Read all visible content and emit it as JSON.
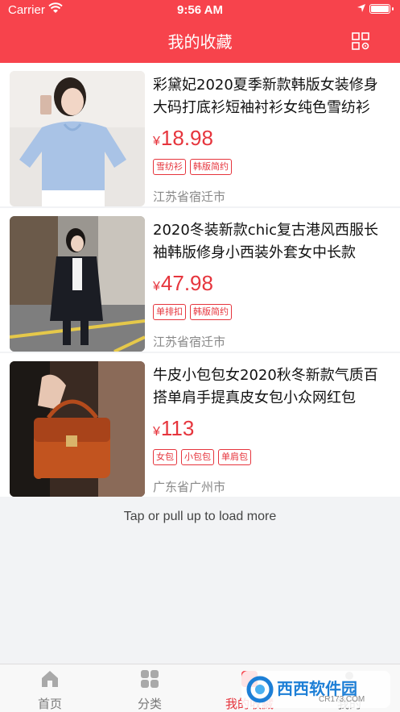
{
  "status": {
    "carrier": "Carrier",
    "time": "9:56 AM"
  },
  "nav": {
    "title": "我的收藏",
    "right_icon": "qr-scan-icon"
  },
  "items": [
    {
      "title": "彩黛妃2020夏季新款韩版女装修身大码打底衫短袖衬衫女纯色雪纺衫",
      "currency": "¥",
      "price": "18.98",
      "tags": [
        "雪纺衫",
        "韩版简约"
      ],
      "location": "江苏省宿迁市"
    },
    {
      "title": "2020冬装新款chic复古港风西服长袖韩版修身小西装外套女中长款",
      "currency": "¥",
      "price": "47.98",
      "tags": [
        "单排扣",
        "韩版简约"
      ],
      "location": "江苏省宿迁市"
    },
    {
      "title": "牛皮小包包女2020秋冬新款气质百搭单肩手提真皮女包小众网红包",
      "currency": "¥",
      "price": "113",
      "tags": [
        "女包",
        "小包包",
        "单肩包"
      ],
      "location": "广东省广州市"
    }
  ],
  "load_more": "Tap or pull up to load more",
  "tabs": [
    {
      "label": "首页",
      "icon": "home-icon",
      "active": false
    },
    {
      "label": "分类",
      "icon": "category-icon",
      "active": false
    },
    {
      "label": "我的收藏",
      "icon": "favorite-icon",
      "active": true
    },
    {
      "label": "我的",
      "icon": "profile-icon",
      "active": false
    }
  ],
  "watermark": {
    "text": "西西软件园",
    "sub": "CR173.COM"
  },
  "colors": {
    "brand": "#f7434c",
    "accent": "#e6353d"
  }
}
